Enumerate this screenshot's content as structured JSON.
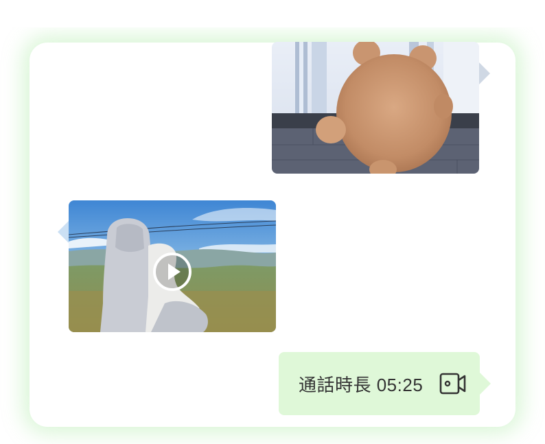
{
  "chat": {
    "messages": [
      {
        "type": "image",
        "side": "right",
        "subject": "bear-plush-at-window"
      },
      {
        "type": "video",
        "side": "left",
        "subject": "person-hugging-dog-on-hill",
        "has_play_button": true
      },
      {
        "type": "call",
        "side": "right",
        "call_text": "通話時長 05:25",
        "icon": "video-camera-icon"
      }
    ]
  },
  "colors": {
    "call_bubble_bg": "#dff8d8",
    "call_text": "#333333",
    "panel_glow": "#96e68c"
  }
}
